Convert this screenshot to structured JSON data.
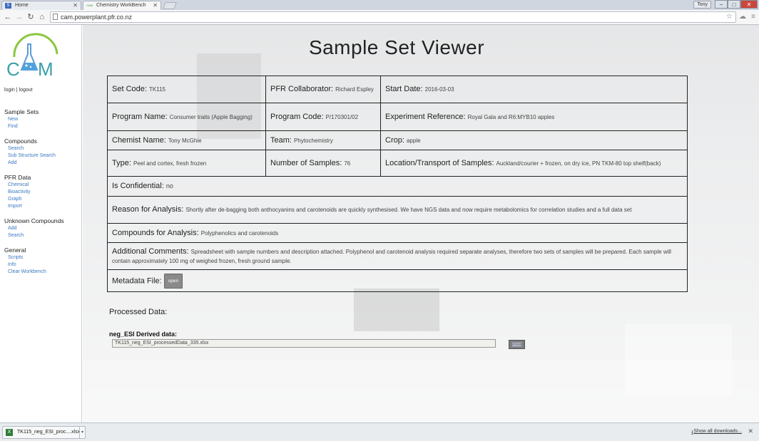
{
  "browser": {
    "tabs": [
      {
        "favicon": "S",
        "label": "Home"
      },
      {
        "favicon": "CAM",
        "label": "Chemistry WorkBench"
      }
    ],
    "user_badge": "Tony",
    "url": "cam.powerplant.pfr.co.nz"
  },
  "sidebar": {
    "logo_text": "CAM",
    "auth": {
      "login": "login",
      "separator": "|",
      "logout": "logout"
    },
    "sections": [
      {
        "title": "Sample Sets",
        "links": [
          "New",
          "Find"
        ]
      },
      {
        "title": "Compounds",
        "links": [
          "Search",
          "Sub Structure Search",
          "Add"
        ]
      },
      {
        "title": "PFR Data",
        "links": [
          "Chemical",
          "Bioactivity",
          "Graph",
          "Import"
        ]
      },
      {
        "title": "Unknown Compounds",
        "links": [
          "Add",
          "Search"
        ]
      },
      {
        "title": "General",
        "links": [
          "Scripts",
          "Info",
          "Clear Workbench"
        ]
      }
    ]
  },
  "main": {
    "title": "Sample Set Viewer",
    "fields": {
      "set_code": {
        "label": "Set Code:",
        "value": "TK115"
      },
      "collaborator": {
        "label": "PFR Collaborator:",
        "value": "Richard Espley"
      },
      "start_date": {
        "label": "Start Date:",
        "value": "2016-03-03"
      },
      "program_name": {
        "label": "Program Name:",
        "value": "Consumer traits (Apple Bagging)"
      },
      "program_code": {
        "label": "Program Code:",
        "value": "P/170301/02"
      },
      "experiment_reference": {
        "label": "Experiment Reference:",
        "value": "Royal Gala and R6:MYB10 apples"
      },
      "chemist_name": {
        "label": "Chemist Name:",
        "value": "Tony McGhie"
      },
      "team": {
        "label": "Team:",
        "value": "Phytochemistry"
      },
      "crop": {
        "label": "Crop:",
        "value": "apple"
      },
      "type": {
        "label": "Type:",
        "value": "Peel and cortex, fresh frozen"
      },
      "number_of_samples": {
        "label": "Number of Samples:",
        "value": "76"
      },
      "location": {
        "label": "Location/Transport of Samples:",
        "value": "Auckland/courier + frozen, on dry ice, PN TKM-80 top shelf(back)"
      },
      "is_confidential": {
        "label": "Is Confidential:",
        "value": "no"
      },
      "reason": {
        "label": "Reason for Analysis:",
        "value": "Shortly after de-bagging both anthocyanins and carotenoids are quickly synthesised. We have NGS data and now require metabolomics for correlation studies and a full data set"
      },
      "compounds": {
        "label": "Compounds for Analysis:",
        "value": "Polyphenolics and carotenoids"
      },
      "comments": {
        "label": "Additional Comments:",
        "value": "Spreadsheet with sample numbers and description attached. Polyphenol and carotenoid analysis required separate analyses, therefore two sets of samples will be prepared. Each sample will contain approximately 100 mg of weighed frozen, fresh ground sample."
      },
      "metadata": {
        "label": "Metadata File:",
        "button": "open"
      }
    },
    "processed": {
      "title": "Processed Data:",
      "derived_title": "neg_ESI Derived data:",
      "file_value": "TK115_neg_ESI_processedData_335.xlsx",
      "open_label": "open"
    }
  },
  "downloads": {
    "item_label": "TK115_neg_ESI_proc....xlsx",
    "show_all": "Show all downloads..."
  }
}
